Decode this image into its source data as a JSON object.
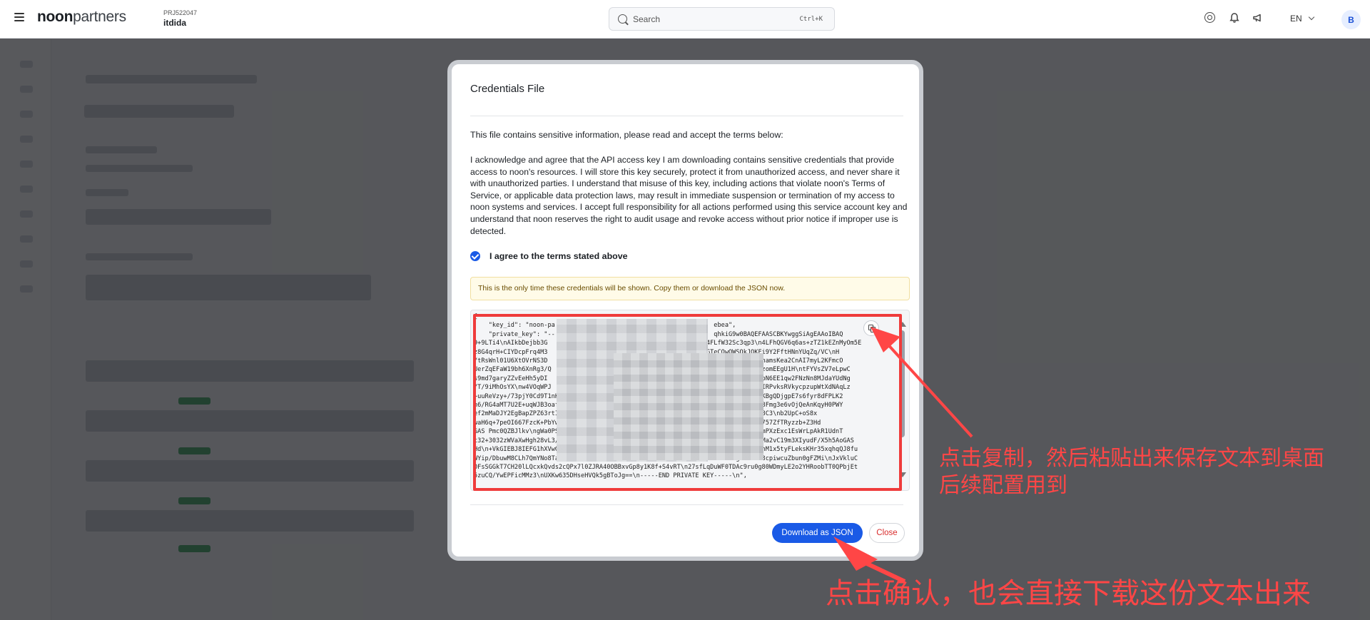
{
  "header": {
    "menu_icon": "hamburger-icon",
    "logo_bold": "noon",
    "logo_light": "partners",
    "project_id": "PRJ522047",
    "project_name": "itdida",
    "search_placeholder": "Search",
    "search_shortcut": "Ctrl+K",
    "language": "EN",
    "avatar_initial": "B"
  },
  "modal": {
    "title": "Credentials File",
    "intro": "This file contains sensitive information, please read and accept the terms below:",
    "terms": "I acknowledge and agree that the API access key I am downloading contains sensitive credentials that provide access to noon's resources. I will store this key securely, protect it from unauthorized access, and never share it with unauthorized parties. I understand that misuse of this key, including actions that violate noon's Terms of Service, or applicable data protection laws, may result in immediate suspension or termination of my access to noon systems and services. I accept full responsibility for all actions performed using this service account key and understand that noon reserves the right to audit usage and revoke access without prior notice if improper use is detected.",
    "agree_label": "I agree to the terms stated above",
    "agree_checked": true,
    "warning": "This is the only time these credentials will be shown. Copy them or download the JSON now.",
    "code_lines": [
      "{",
      "    \"key_id\": \"noon-pa                                           ebea\",",
      "    \"private_key\": \"--                                           qhkiG9w0BAQEFAASCBKYwggSiAgEAAoIBAQ",
      "9+9LTi4\\nAIkbDejbb3G                                           4FLfW32Sc3qp3\\n4LFhQGV6q6as+zTZ1kEZnMyOm5E",
      "z8G4qrH+CIYDcpFrq4M3                                           GTeCOwOWSOkJQKFi9Y2FftHNnYUqZq/VC\\nH",
      "/tRsWnl01U6XtOVrNS3D                                           cCl+lp7mRCczAlnhamsKea2CnAI7myL2KFmcO",
      "UerZqEFaW19bh6XnRg3/Q                                           PRsHrhftTDz2jJzomEEgU1H\\ntFYVsZV7eLpwC",
      "s9md7garyZZvEeHh5yDI                                           v8KAPabf6bXNYn2pN6EE1qw2FNzNn8MJdaYUdNg",
      "/T/9iMhOsYX\\nw4VOqWPJ                                           86lciHV4MCS\\nXIRPvksRVkycpzupWtXdNAqLz",
      "+uuReVzy+/73pjY0Cd9T1nKnh                                       8E9PRo6lZjPWcQKBgQDjgpE7s6fyr8dFPLK2",
      "n6/RG4aMT7U2E+uqWJB3oaf                                         +sz Q8z4GCdNg58Fmg3e6vOjQeAnKqyH0PWY",
      "ef2mMaDJY2EgBapZPZ63rtIE                                        F0LsNjTopiTSYp8C3\\nb2UpC+oS8x",
      "waH6q+7peOI667FzcK+PbYwESlcnj5iCPRVYWM                          E/6cvgfSLBZN/M757ZfTRyzzb+Z3Hd",
      "GAS Pmc0QZBJlkv\\ngWa0PSyi2wKBgHrejxURJ8j3icUozNP           YLbru/TCTxz8d2dXI\\nmPXzExc1EsWrLpAkR1UdnT",
      "t32+3032zWVaXwHgh28vL3/LAHzSnw9ffbOfVFJLy\\nM67aO8OrLASrcxt2GccOUdd1Sus8S8OetjmMa2vC19m3XIyudF/X5h5AoGAS",
      "Hd\\n+VkGIEBJ8IEFG1hXVwGMKLihQXsu+d6sv1Qxe9j/RGNjnGCt97WZrIGegzavieTx\\nXujqRQ3phM1x5tyFLeksKHr35xqhqQJ8fu",
      "WYip/DbuwM8CLh7QmYNo8Tas/fOCB\\n6hYxvLzk7Q0S2E0aaOMJAH5C6TZ/8Mh2NHb4SOkCgY8lKdz3cpiwcuZbun0gFZMi\\nJxVkluC",
      "0FsSGGkT7CH20lLQcxkQvds2cQPx7l0ZJRA40OBBxvGp8y1K8f+S4vRT\\n27sfLqDuWF0TDAc9ru0g80WDmyLE2o2YHRoobTT0QPbjEt",
      "5zuCQ/YwEPFicMMz3\\nUXKw635DHseHVQk5gBToJg==\\n-----END PRIVATE KEY-----\\n\","
    ],
    "copy_icon": "copy-icon",
    "download_label": "Download as JSON",
    "close_label": "Close"
  },
  "annotations": {
    "copy_note_line1": "点击复制，然后粘贴出来保存文本到桌面",
    "copy_note_line2": "后续配置用到",
    "download_note": "点击确认，也会直接下载这份文本出来",
    "color": "#ff4646"
  },
  "colors": {
    "primary": "#1a5ae6",
    "danger": "#d92d2d",
    "highlight": "#ef3b3b"
  }
}
